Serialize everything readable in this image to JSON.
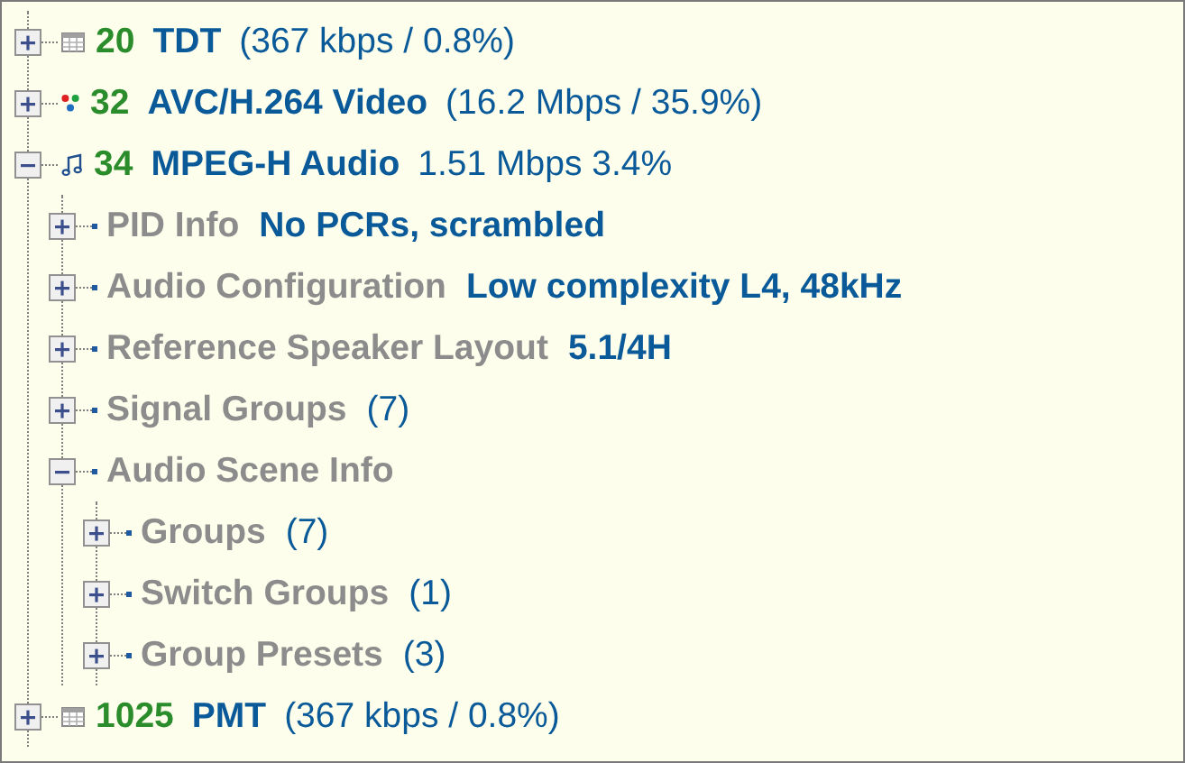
{
  "tree": [
    {
      "kind": "table",
      "pid": "20",
      "name": "TDT",
      "info": "(367 kbps / 0.8%)",
      "expanded": false
    },
    {
      "kind": "video",
      "pid": "32",
      "name": "AVC/H.264 Video",
      "info": "(16.2 Mbps / 35.9%)",
      "expanded": false
    },
    {
      "kind": "audio",
      "pid": "34",
      "name": "MPEG-H Audio",
      "info": "1.51 Mbps 3.4%",
      "expanded": true,
      "children": [
        {
          "label": "PID Info",
          "value": "No PCRs, scrambled",
          "kind": "detail",
          "expanded": false
        },
        {
          "label": "Audio Configuration",
          "value": "Low complexity L4, 48kHz",
          "kind": "detail",
          "expanded": false
        },
        {
          "label": "Reference Speaker Layout",
          "value": "5.1/4H",
          "kind": "detail",
          "expanded": false
        },
        {
          "label": "Signal Groups",
          "value": "(7)",
          "kind": "count",
          "expanded": false
        },
        {
          "label": "Audio Scene Info",
          "expanded": true,
          "children": [
            {
              "label": "Groups",
              "value": "(7)",
              "kind": "count",
              "expanded": false
            },
            {
              "label": "Switch Groups",
              "value": "(1)",
              "kind": "count",
              "expanded": false
            },
            {
              "label": "Group Presets",
              "value": "(3)",
              "kind": "count",
              "expanded": false
            }
          ]
        }
      ]
    },
    {
      "kind": "table",
      "pid": "1025",
      "name": "PMT",
      "info": "(367 kbps / 0.8%)",
      "expanded": false
    }
  ]
}
